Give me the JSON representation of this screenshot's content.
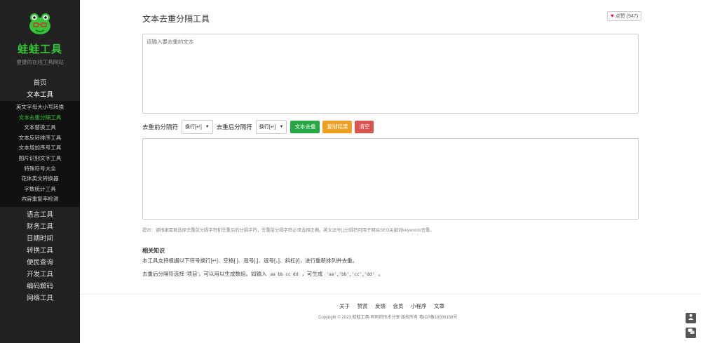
{
  "brand": {
    "name": "蛙蛙工具",
    "tagline": "便捷的在线工具网站",
    "accent": "#35c33a"
  },
  "nav": {
    "home": "首页",
    "text_tools": "文本工具",
    "sub_items": [
      "英文字母大小写转换",
      "文本去重分隔工具",
      "文本替换工具",
      "文本反转排序工具",
      "文本增加序号工具",
      "图片识别文字工具",
      "特殊符号大全",
      "花体英文转换器",
      "字数统计工具",
      "内容重复率检测"
    ],
    "active_index": 1,
    "rest": [
      "语言工具",
      "财务工具",
      "日期时间",
      "转换工具",
      "便民查询",
      "开发工具",
      "编码解码",
      "网络工具"
    ]
  },
  "main": {
    "title": "文本去重分隔工具",
    "like_label": "点赞",
    "like_count": "(947)",
    "input_placeholder": "请输入要去重的文本",
    "before_label": "去重前分隔符",
    "before_value": "换行[↵]",
    "after_label": "去重后分隔符",
    "after_value": "换行[↵]",
    "btn_dedupe": "文本去重",
    "btn_copy": "复制结果",
    "btn_clear": "清空",
    "hint": "提示：请根据需要选择去重前分隔字符和去重后的分隔字符，去重前分隔字符必须选择正确。英文逗号[,]分隔符可用于网站SEO关键词keywords去重。",
    "knowledge_title": "相关知识",
    "k1": "本工具支持根据以下符号换行[↵]、空格[ ]、逗号[,]、逗号[，]、斜杠[/]，进行重新排列并去重。",
    "k2_a": "去重后分隔符选择 '项目'，可以用以生成数组。如输入",
    "k2_code1": "aa bb cc dd",
    "k2_b": "，可生成",
    "k2_code2": "'aa','bb','cc','dd'",
    "k2_c": "。"
  },
  "footer": {
    "links": [
      "关于",
      "赞赏",
      "反馈",
      "会员",
      "小程序",
      "文章"
    ],
    "separator": "·",
    "copyright": "Copyright © 2023 蛙蛙工具-阿阿的技术分享 版权所有 粤ICP备18006158号"
  },
  "float": {
    "top_icon": "user-icon",
    "bottom_icon": "chat-icon"
  }
}
